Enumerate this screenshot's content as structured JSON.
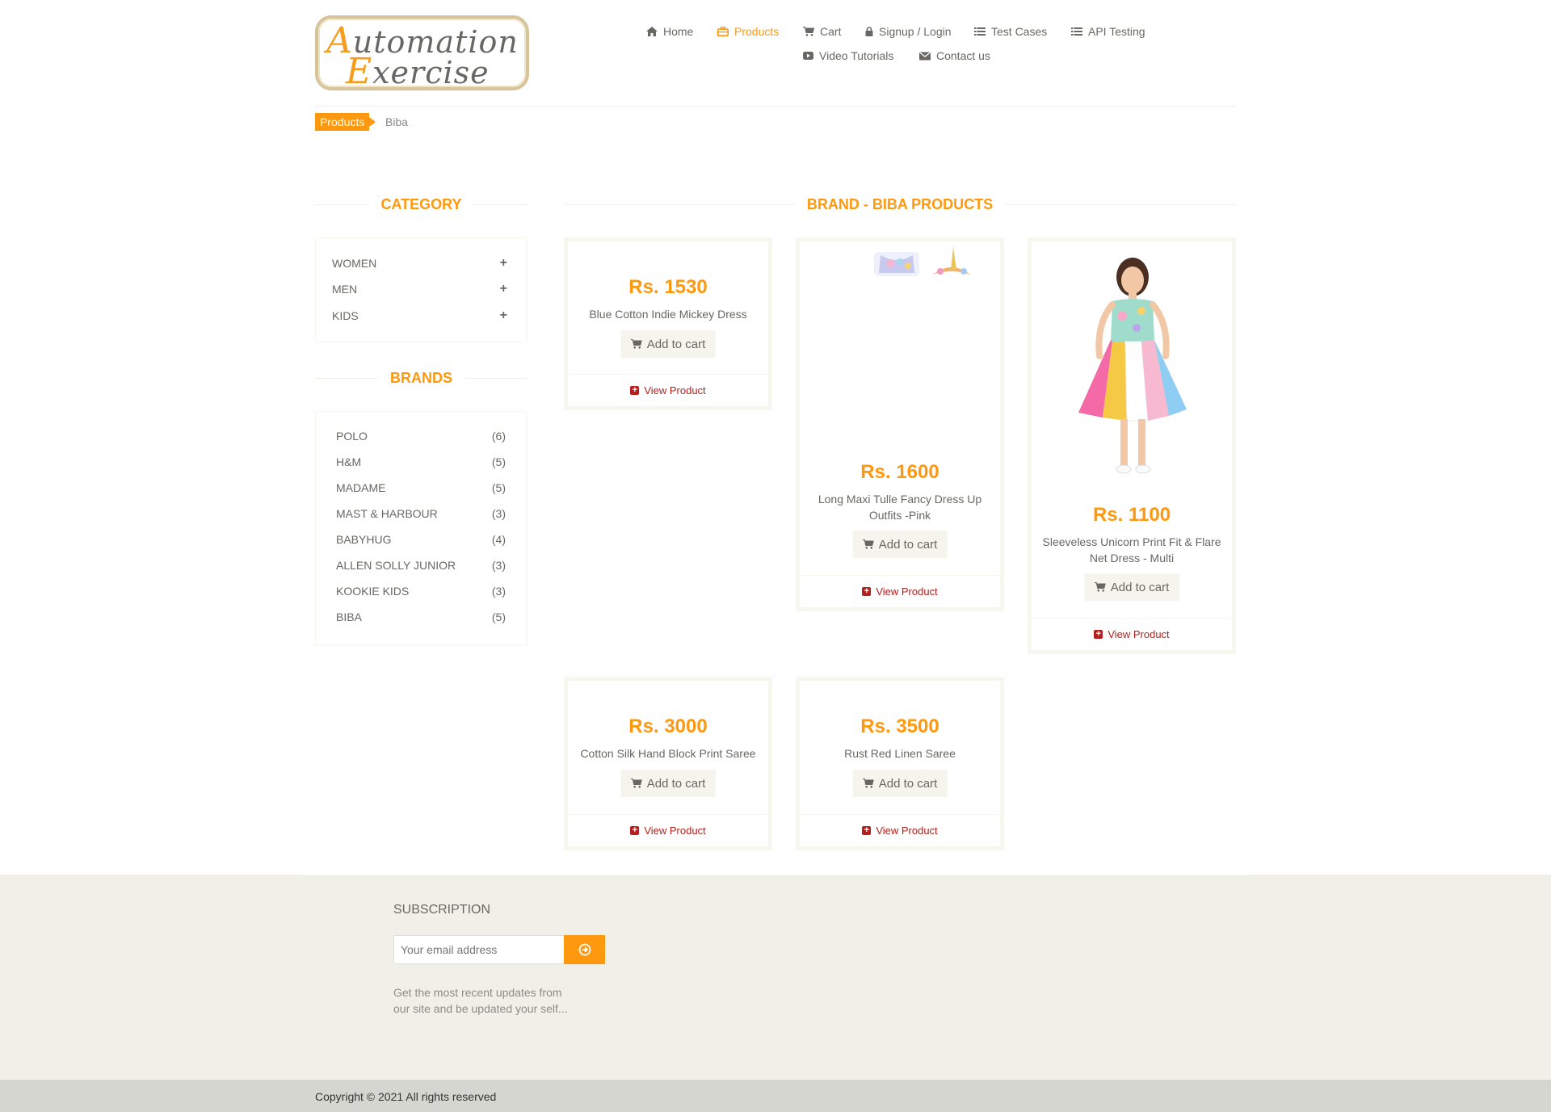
{
  "header": {
    "logo_text_line1": "Automation",
    "logo_text_line2": "Exercise",
    "nav": [
      {
        "label": "Home",
        "icon": "home-icon"
      },
      {
        "label": "Products",
        "icon": "briefcase-icon",
        "active": true
      },
      {
        "label": "Cart",
        "icon": "cart-icon"
      },
      {
        "label": "Signup / Login",
        "icon": "lock-icon"
      },
      {
        "label": "Test Cases",
        "icon": "list-icon"
      },
      {
        "label": "API Testing",
        "icon": "list-icon"
      },
      {
        "label": "Video Tutorials",
        "icon": "youtube-play-icon"
      },
      {
        "label": "Contact us",
        "icon": "envelope-icon"
      }
    ]
  },
  "breadcrumb": {
    "parent": "Products",
    "current": "Biba"
  },
  "sidebar": {
    "category_title": "Category",
    "categories": [
      {
        "label": "Women"
      },
      {
        "label": "Men"
      },
      {
        "label": "Kids"
      }
    ],
    "brands_title": "Brands",
    "brands": [
      {
        "name": "POLO",
        "count": "(6)"
      },
      {
        "name": "H&M",
        "count": "(5)"
      },
      {
        "name": "MADAME",
        "count": "(5)"
      },
      {
        "name": "MAST & HARBOUR",
        "count": "(3)"
      },
      {
        "name": "BABYHUG",
        "count": "(4)"
      },
      {
        "name": "ALLEN SOLLY JUNIOR",
        "count": "(3)"
      },
      {
        "name": "KOOKIE KIDS",
        "count": "(3)"
      },
      {
        "name": "BIBA",
        "count": "(5)"
      }
    ]
  },
  "main": {
    "title": "Brand - Biba Products",
    "add_to_cart_label": "Add to cart",
    "view_product_label": "View Product",
    "products": [
      {
        "price": "Rs. 1530",
        "name": "Blue Cotton Indie Mickey Dress"
      },
      {
        "price": "Rs. 1600",
        "name": "Long Maxi Tulle Fancy Dress Up Outfits -Pink"
      },
      {
        "price": "Rs. 1100",
        "name": "Sleeveless Unicorn Print Fit & Flare Net Dress - Multi"
      },
      {
        "price": "Rs. 3000",
        "name": "Cotton Silk Hand Block Print Saree"
      },
      {
        "price": "Rs. 3500",
        "name": "Rust Red Linen Saree"
      }
    ]
  },
  "footer": {
    "subscription_title": "Subscription",
    "email_placeholder": "Your email address",
    "subscription_desc": "Get the most recent updates from our site and be updated your self...",
    "copyright": "Copyright © 2021 All rights reserved"
  },
  "colors": {
    "accent": "#fe980f",
    "text": "#696763",
    "footer_bg": "#f0f0e9",
    "link_red": "#b4201d"
  }
}
